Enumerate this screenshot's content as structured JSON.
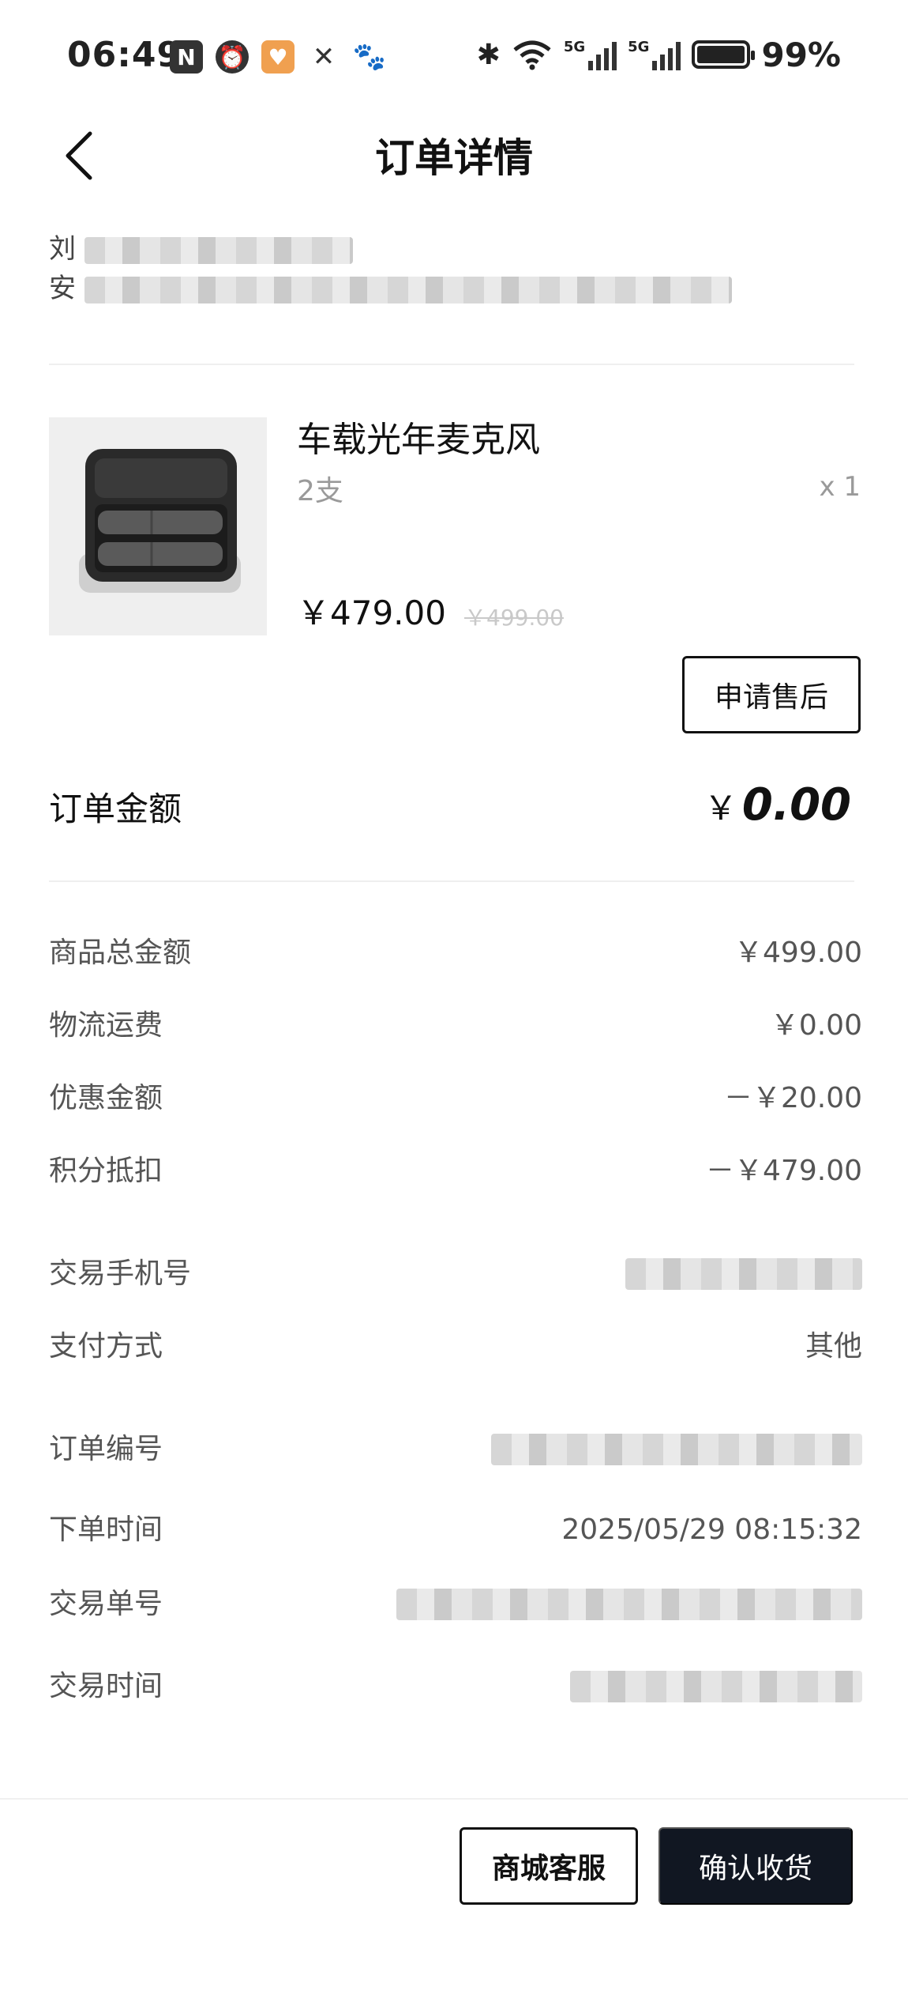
{
  "status_bar": {
    "time": "06:49",
    "battery_percent": "99%",
    "network_labels": [
      "5G",
      "5G"
    ],
    "battery_level": 0.99
  },
  "nav": {
    "title": "订单详情"
  },
  "address": {
    "line1_visible": "刘",
    "line2_visible": "安"
  },
  "product": {
    "name": "车载光年麦克风",
    "spec": "2支",
    "quantity": "x 1",
    "price": "￥479.00",
    "original_price": "￥499.00",
    "after_sale_label": "申请售后"
  },
  "order_amount": {
    "label": "订单金额",
    "currency": "￥",
    "value": "0.00"
  },
  "fee_rows": [
    {
      "key": "商品总金额",
      "value": "￥499.00"
    },
    {
      "key": "物流运费",
      "value": "￥0.00"
    },
    {
      "key": "优惠金额",
      "value": "－￥20.00"
    },
    {
      "key": "积分抵扣",
      "value": "－￥479.00"
    }
  ],
  "payment_rows": [
    {
      "key": "交易手机号",
      "value": ""
    },
    {
      "key": "支付方式",
      "value": "其他"
    }
  ],
  "order_rows": [
    {
      "key": "订单编号",
      "value": ""
    },
    {
      "key": "下单时间",
      "value": "2025/05/29 08:15:32"
    },
    {
      "key": "交易单号",
      "value": ""
    },
    {
      "key": "交易时间",
      "value": ""
    }
  ],
  "bottom_bar": {
    "service_label": "商城客服",
    "confirm_label": "确认收货"
  },
  "colors": {
    "primary_button": "#111722",
    "text_muted": "#9a9a9a"
  }
}
